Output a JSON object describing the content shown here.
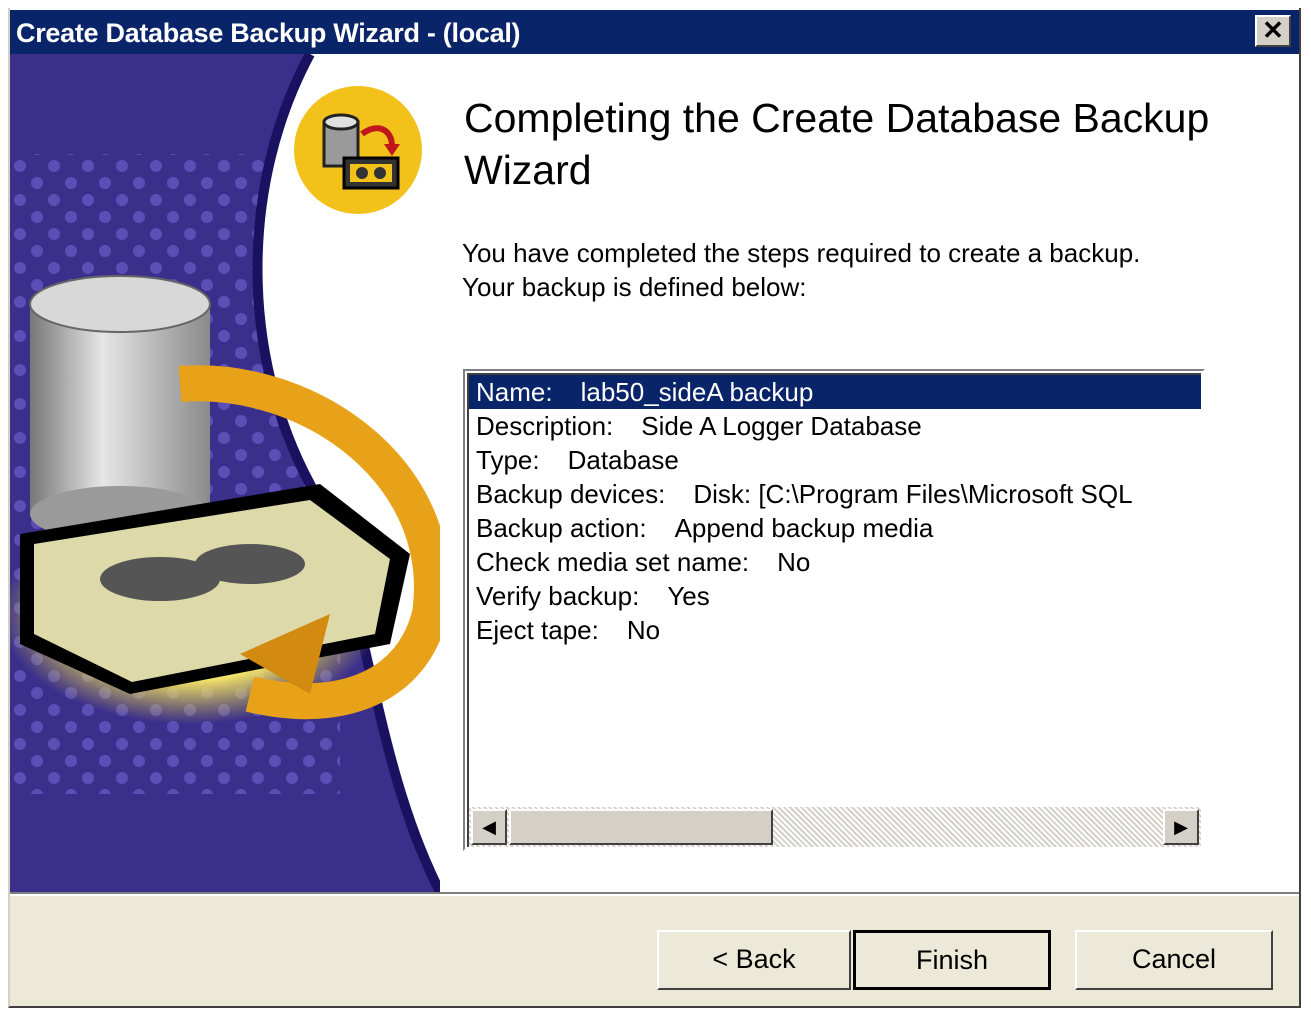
{
  "window": {
    "title": "Create Database Backup Wizard - (local)",
    "close_label": "✕"
  },
  "main": {
    "heading": "Completing the Create Database Backup Wizard",
    "intro_line1": "You have completed the steps required to create a backup.",
    "intro_line2": "Your backup is defined below:"
  },
  "summary": {
    "rows": [
      {
        "label": "Name:",
        "value": "lab50_sideA backup",
        "selected": true
      },
      {
        "label": "Description:",
        "value": "Side A Logger Database"
      },
      {
        "label": "Type:",
        "value": "Database"
      },
      {
        "label": "Backup devices:",
        "value": "Disk: [C:\\Program Files\\Microsoft SQL"
      },
      {
        "label": "Backup action:",
        "value": "Append backup media"
      },
      {
        "label": "Check media set name:",
        "value": "No"
      },
      {
        "label": "Verify backup:",
        "value": "Yes"
      },
      {
        "label": "Eject tape:",
        "value": "No"
      }
    ]
  },
  "scrollbar": {
    "left_arrow": "◀",
    "right_arrow": "▶"
  },
  "buttons": {
    "back": "< Back",
    "finish": "Finish",
    "cancel": "Cancel"
  },
  "icons": [
    "close-icon",
    "backup-wizard-icon",
    "scroll-left-icon",
    "scroll-right-icon"
  ],
  "colors": {
    "titlebar": "#0a246a",
    "selection": "#0a246a",
    "footer": "#ece9d8",
    "art_purple": "#3b2f8c",
    "art_gold": "#f2c21a"
  }
}
